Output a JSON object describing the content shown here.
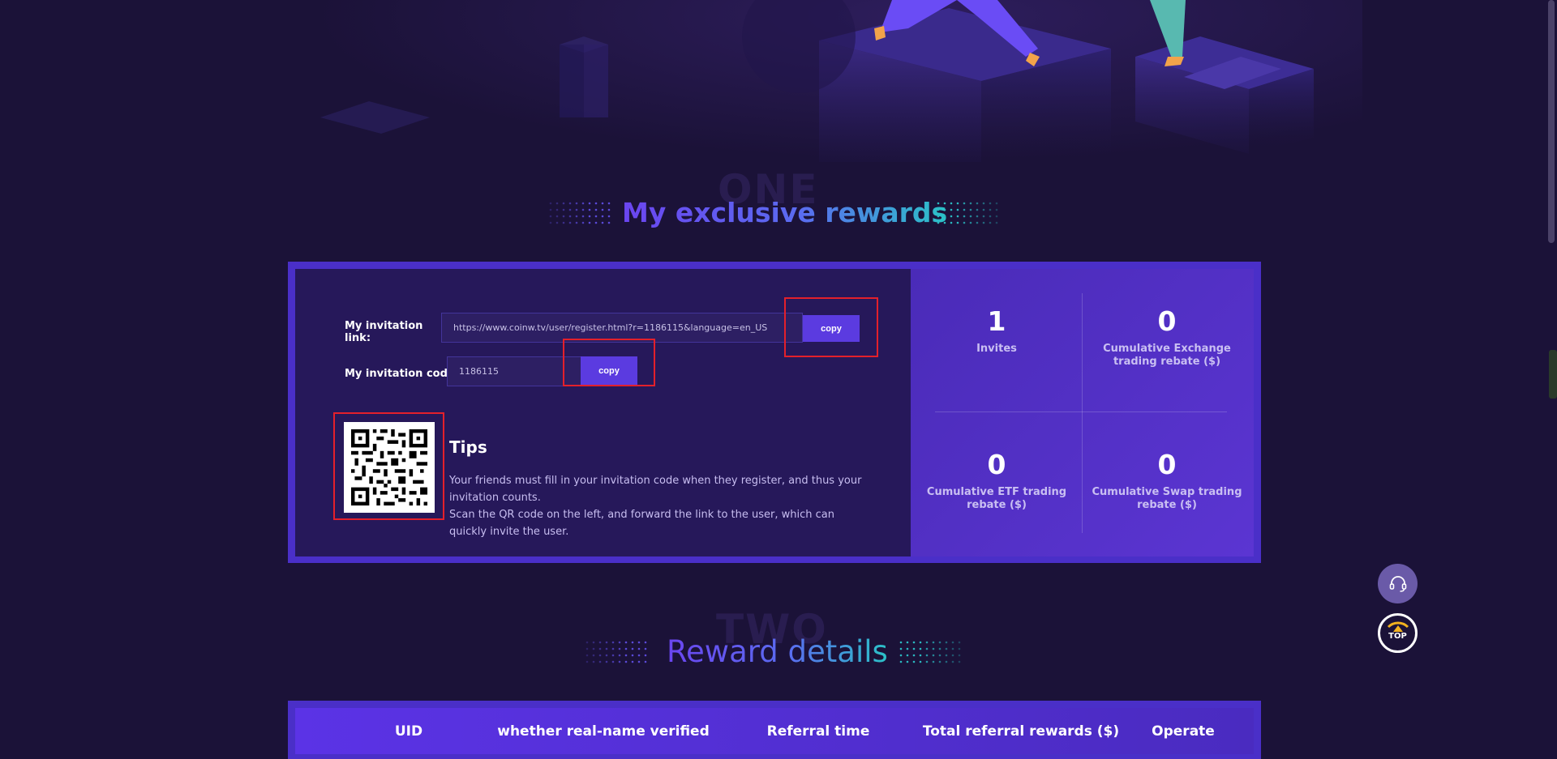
{
  "section_one": {
    "ghost": "ONE",
    "title": "My exclusive rewards"
  },
  "invitation": {
    "link_label_line1": "My invitation",
    "link_label_line2": "link:",
    "link_value": "https://www.coinw.tv/user/register.html?r=1186115&language=en_US",
    "link_copy": "copy",
    "code_label": "My invitation code:",
    "code_value": "1186115",
    "code_copy": "copy"
  },
  "tips": {
    "title": "Tips",
    "line1": "Your friends must fill in your invitation code when they register, and thus your invitation counts.",
    "line2": "Scan the QR code on the left, and forward the link to the user, which can quickly invite the user."
  },
  "stats": [
    {
      "value": "1",
      "label": "Invites"
    },
    {
      "value": "0",
      "label": "Cumulative Exchange trading rebate ($)"
    },
    {
      "value": "0",
      "label": "Cumulative ETF trading rebate ($)"
    },
    {
      "value": "0",
      "label": "Cumulative Swap trading rebate ($)"
    }
  ],
  "section_two": {
    "ghost": "TWO",
    "title": "Reward details"
  },
  "table": {
    "columns": [
      "UID",
      "whether real-name verified",
      "Referral time",
      "Total referral rewards ($)",
      "Operate"
    ]
  },
  "widgets": {
    "top_label": "TOP",
    "support_icon": "headset-icon",
    "top_icon": "arrow-up-icon"
  },
  "colors": {
    "accent": "#5b3be0",
    "highlight_frame": "#e3202b",
    "title_gradient_start": "#6b45f0",
    "title_gradient_end": "#2bc2c7"
  }
}
